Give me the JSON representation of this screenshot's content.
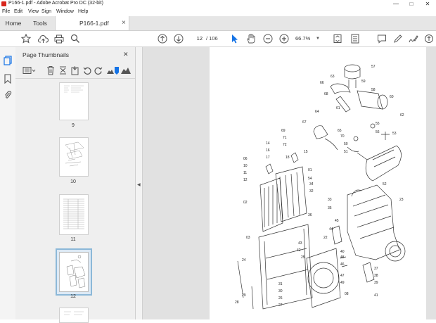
{
  "window": {
    "title": "P166-1.pdf - Adobe Acrobat Pro DC (32-bit)",
    "controls": [
      "—",
      "□",
      "✕"
    ]
  },
  "menu": [
    "File",
    "Edit",
    "View",
    "Sign",
    "Window",
    "Help"
  ],
  "tabs": {
    "home": "Home",
    "tools": "Tools",
    "document": "P166-1.pdf",
    "close_glyph": "×"
  },
  "toolbar": {
    "page_current": "12",
    "page_total": "/ 106",
    "zoom": "66.7%"
  },
  "panel": {
    "title": "Page Thumbnails",
    "close_glyph": "✕"
  },
  "thumbnails": [
    {
      "label": "9"
    },
    {
      "label": "10"
    },
    {
      "label": "11"
    },
    {
      "label": "12",
      "selected": true
    }
  ],
  "diagram_labels": [
    "57",
    "63",
    "66",
    "59",
    "58",
    "60",
    "68",
    "64",
    "61",
    "62",
    "55",
    "53",
    "56",
    "67",
    "69",
    "65",
    "70",
    "15",
    "50",
    "51",
    "71",
    "72",
    "16",
    "17",
    "18",
    "14",
    "06",
    "10",
    "11",
    "12",
    "01",
    "34",
    "32",
    "33",
    "35",
    "36",
    "02",
    "22",
    "23",
    "25",
    "54",
    "24",
    "40",
    "47",
    "37",
    "38",
    "39",
    "52",
    "03",
    "26",
    "27",
    "28",
    "29",
    "30",
    "31",
    "41",
    "42",
    "43",
    "44",
    "45",
    "46",
    "48",
    "49",
    "08"
  ],
  "colors": {
    "accent_blue": "#1473e6",
    "tab_active": "#ffffff",
    "doc_background": "#e1e1e1",
    "panel_background": "#efefef"
  }
}
